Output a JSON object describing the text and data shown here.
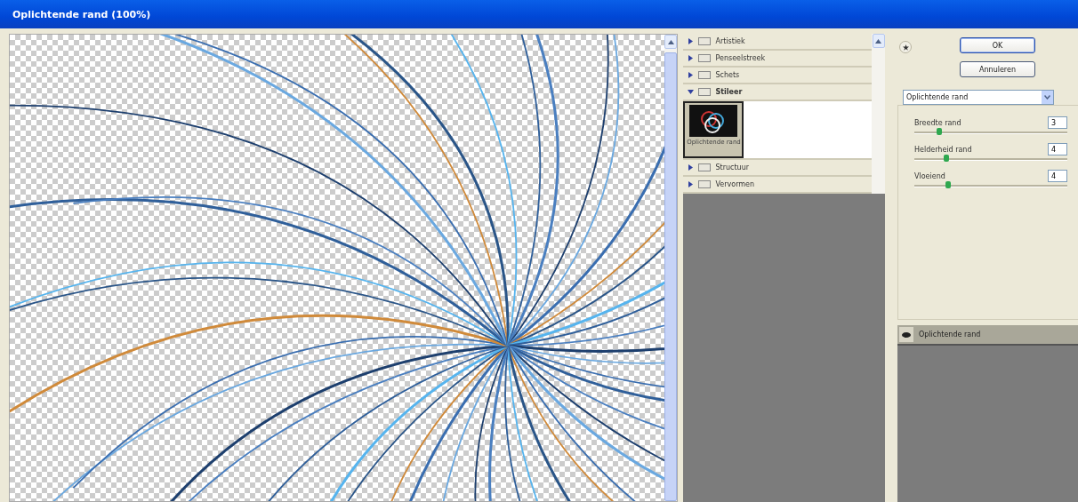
{
  "window": {
    "title": "Oplichtende rand (100%)"
  },
  "categories": [
    {
      "label": "Artistiek",
      "expanded": false
    },
    {
      "label": "Penseelstreek",
      "expanded": false
    },
    {
      "label": "Schets",
      "expanded": false
    },
    {
      "label": "Stileer",
      "expanded": true,
      "filters": [
        {
          "label": "Oplichtende rand",
          "selected": true
        }
      ]
    },
    {
      "label": "Structuur",
      "expanded": false
    },
    {
      "label": "Vervormen",
      "expanded": false
    }
  ],
  "buttons": [
    {
      "label": "OK",
      "kind": "default"
    },
    {
      "label": "Annuleren",
      "kind": "normal"
    }
  ],
  "filter_select": {
    "value": "Oplichtende rand"
  },
  "settings": [
    {
      "label": "Breedte rand",
      "value": "3",
      "level": 0.16
    },
    {
      "label": "Helderheid rand",
      "value": "4",
      "level": 0.21
    },
    {
      "label": "Vloeiend",
      "value": "4",
      "level": 0.22
    }
  ],
  "layers": [
    {
      "label": "Oplichtende rand",
      "visible": true
    }
  ]
}
